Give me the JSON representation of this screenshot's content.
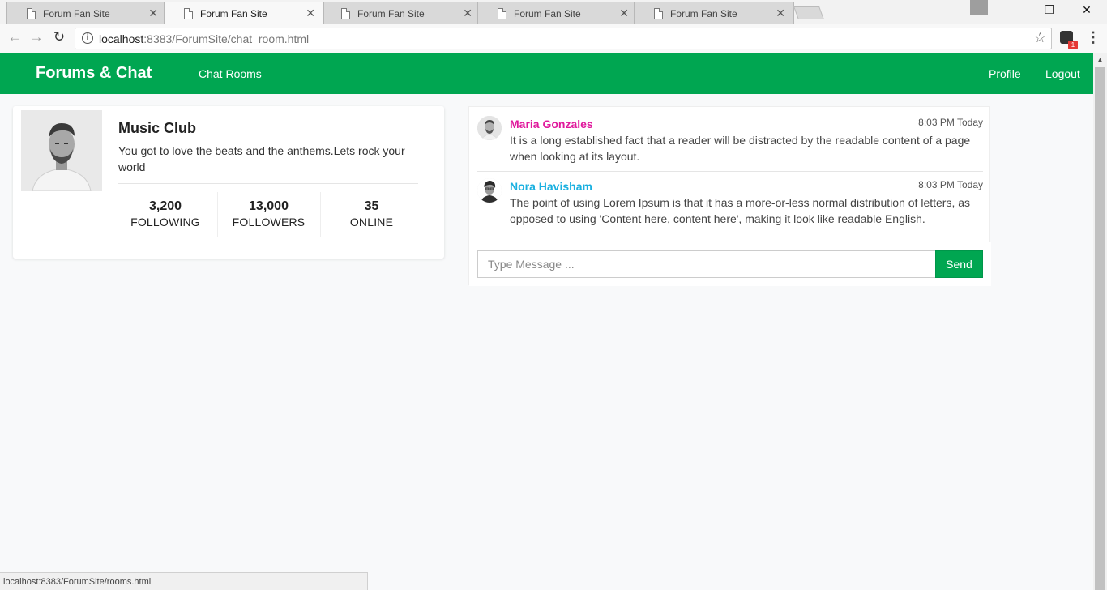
{
  "browser": {
    "tabs": [
      {
        "title": "Forum Fan Site",
        "active": false
      },
      {
        "title": "Forum Fan Site",
        "active": true
      },
      {
        "title": "Forum Fan Site",
        "active": false
      },
      {
        "title": "Forum Fan Site",
        "active": false
      },
      {
        "title": "Forum Fan Site",
        "active": false
      }
    ],
    "url_host": "localhost",
    "url_rest": ":8383/ForumSite/chat_room.html",
    "extension_badge": "1",
    "status_text": "localhost:8383/ForumSite/rooms.html"
  },
  "navbar": {
    "brand": "Forums & Chat",
    "chat_rooms": "Chat Rooms",
    "profile": "Profile",
    "logout": "Logout"
  },
  "room": {
    "title": "Music Club",
    "description": "You got to love the beats and the anthems.Lets rock your world",
    "stats": [
      {
        "value": "3,200",
        "label": "FOLLOWING"
      },
      {
        "value": "13,000",
        "label": "FOLLOWERS"
      },
      {
        "value": "35",
        "label": "ONLINE"
      }
    ]
  },
  "chat": {
    "messages": [
      {
        "name": "Maria Gonzales",
        "time": "8:03 PM Today",
        "text": "It is a long established fact that a reader will be distracted by the readable content of a page when looking at its layout.",
        "color": "#e0189c"
      },
      {
        "name": "Nora Havisham",
        "time": "8:03 PM Today",
        "text": "The point of using Lorem Ipsum is that it has a more-or-less normal distribution of letters, as opposed to using 'Content here, content here', making it look like readable English.",
        "color": "#1ab0e0"
      }
    ],
    "input_placeholder": "Type Message ...",
    "send_label": "Send"
  },
  "colors": {
    "brand_green": "#00a651"
  }
}
